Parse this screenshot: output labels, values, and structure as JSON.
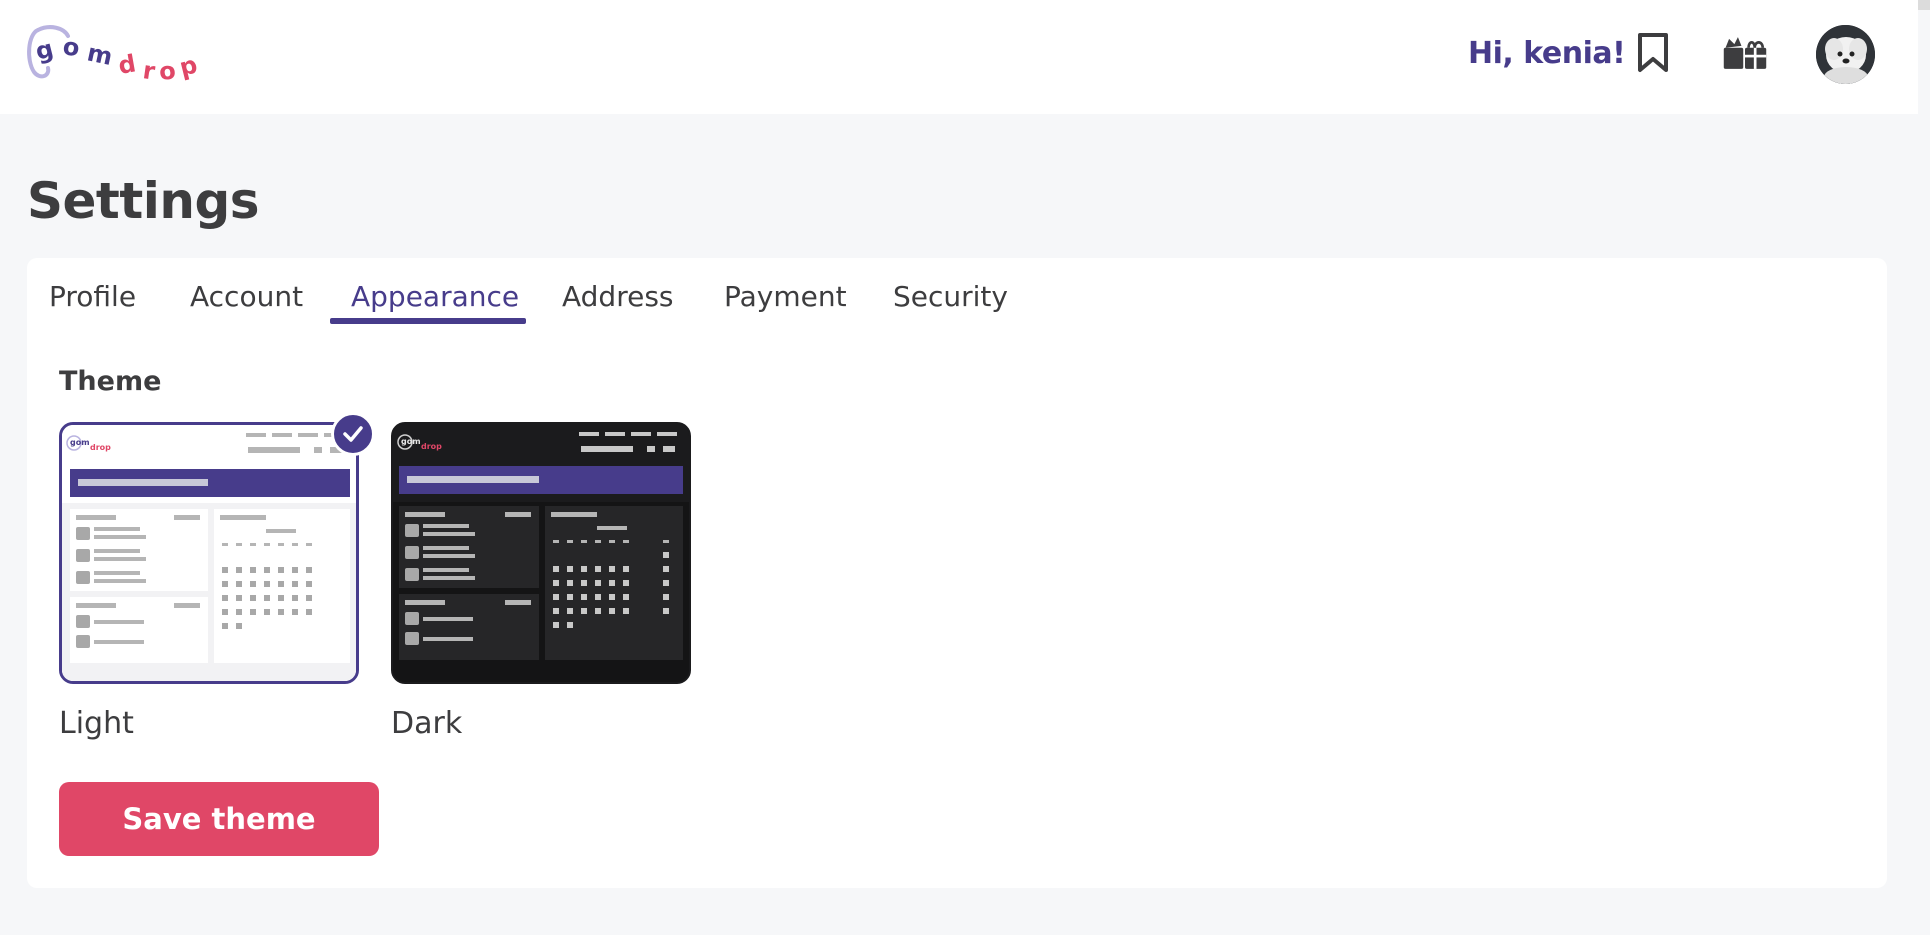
{
  "header": {
    "logo_text": "gomdrop",
    "greeting": "Hi, kenia!",
    "bookmark_icon": "bookmark-icon",
    "gift_icon": "gift-icon",
    "avatar": "user-avatar"
  },
  "page": {
    "title": "Settings"
  },
  "tabs": [
    {
      "label": "Profile",
      "active": false
    },
    {
      "label": "Account",
      "active": false
    },
    {
      "label": "Appearance",
      "active": true
    },
    {
      "label": "Address",
      "active": false
    },
    {
      "label": "Payment",
      "active": false
    },
    {
      "label": "Security",
      "active": false
    }
  ],
  "appearance": {
    "section_label": "Theme",
    "themes": [
      {
        "name": "Light",
        "selected": true
      },
      {
        "name": "Dark",
        "selected": false
      }
    ],
    "save_label": "Save theme"
  },
  "colors": {
    "accent": "#473c8b",
    "primary_button": "#e04767",
    "background": "#f6f7f9"
  }
}
